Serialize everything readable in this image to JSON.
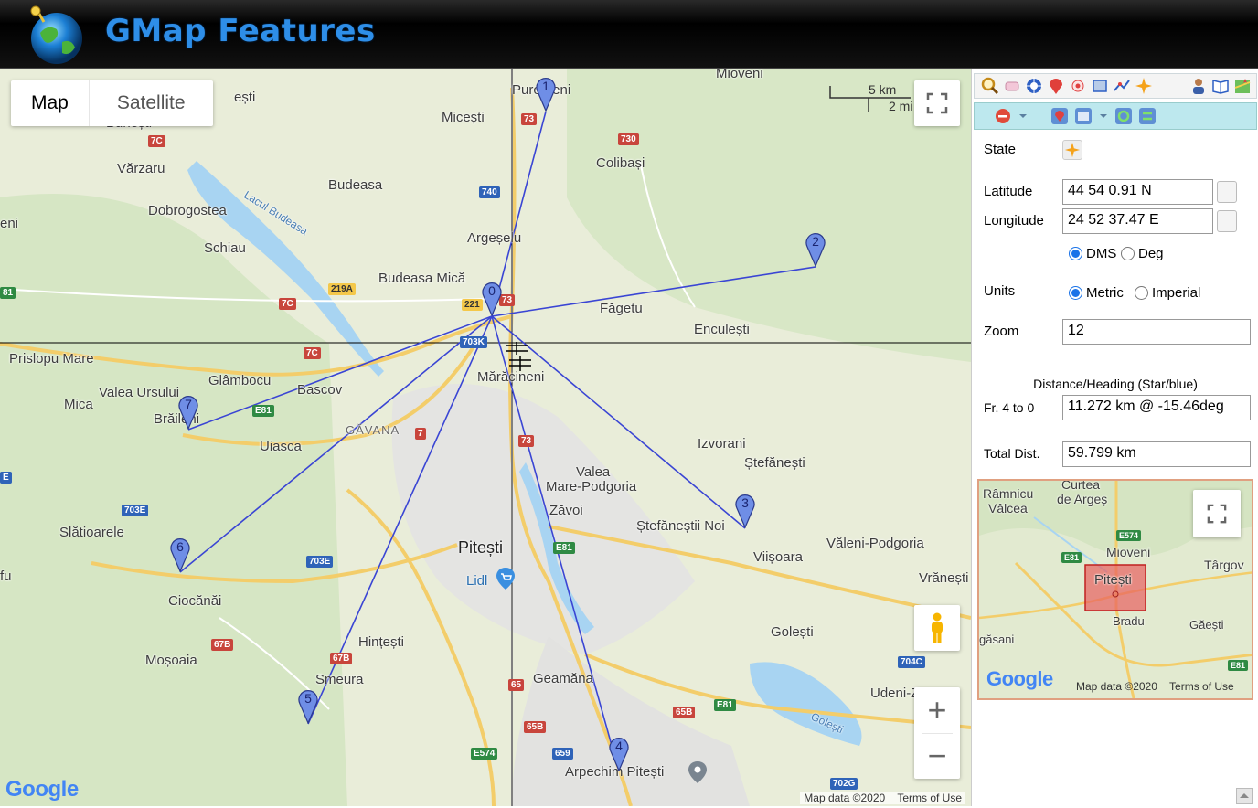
{
  "header": {
    "title": "GMap Features"
  },
  "map": {
    "map_type_buttons": [
      "Map",
      "Satellite"
    ],
    "scale": {
      "km": "5 km",
      "mi": "2 mi"
    },
    "footer": {
      "data": "Map data ©2020",
      "terms": "Terms of Use"
    },
    "google_logo": "Google",
    "places": [
      {
        "id": "p1",
        "text": "Mioveni"
      },
      {
        "id": "p2",
        "text": "Purcăreni"
      },
      {
        "id": "p3",
        "text": "Micești"
      },
      {
        "id": "p4",
        "text": "Colibași"
      },
      {
        "id": "p5",
        "text": "Vărzaru"
      },
      {
        "id": "p6",
        "text": "Budeasa"
      },
      {
        "id": "p7",
        "text": "Dobrogostea"
      },
      {
        "id": "p8",
        "text": "Schiau"
      },
      {
        "id": "p9",
        "text": "Argeșelu"
      },
      {
        "id": "p10",
        "text": "Budeasa Mică"
      },
      {
        "id": "p11",
        "text": "Făgetu"
      },
      {
        "id": "p12",
        "text": "Enculești"
      },
      {
        "id": "p13",
        "text": "Prislopu Mare"
      },
      {
        "id": "p14",
        "text": "Glâmbocu"
      },
      {
        "id": "p15",
        "text": "Valea Ursului"
      },
      {
        "id": "p16",
        "text": "Mica"
      },
      {
        "id": "p17",
        "text": "Brăileni"
      },
      {
        "id": "p18",
        "text": "Bascov"
      },
      {
        "id": "p19",
        "text": "Mărăcineni"
      },
      {
        "id": "p20",
        "text": "Uiasca"
      },
      {
        "id": "p21",
        "text": "Izvorani"
      },
      {
        "id": "p22",
        "text": "Ștefănești"
      },
      {
        "id": "p23",
        "text": "Valea"
      },
      {
        "id": "p24",
        "text": "Mare-Podgoria"
      },
      {
        "id": "p25",
        "text": "Zăvoi"
      },
      {
        "id": "p26",
        "text": "Ștefăneștii Noi"
      },
      {
        "id": "p27",
        "text": "Slătioarele"
      },
      {
        "id": "p28",
        "text": "Pitești"
      },
      {
        "id": "p29",
        "text": "Viișoara"
      },
      {
        "id": "p30",
        "text": "Văleni-Podgoria"
      },
      {
        "id": "p31",
        "text": "Lidl"
      },
      {
        "id": "p32",
        "text": "Vrănești"
      },
      {
        "id": "p33",
        "text": "Ciocănăi"
      },
      {
        "id": "p34",
        "text": "Moșoaia"
      },
      {
        "id": "p35",
        "text": "Hințești"
      },
      {
        "id": "p36",
        "text": "Golești"
      },
      {
        "id": "p37",
        "text": "Smeura"
      },
      {
        "id": "p38",
        "text": "Geamăna"
      },
      {
        "id": "p39",
        "text": "Udeni-Z"
      },
      {
        "id": "p40",
        "text": "Arpechim Pitești"
      },
      {
        "id": "p41",
        "text": "Lacul Budeasa"
      },
      {
        "id": "p42",
        "text": "GĂVANA"
      },
      {
        "id": "p43",
        "text": "Golești"
      },
      {
        "id": "p44",
        "text": "ești"
      },
      {
        "id": "p45",
        "text": "Bunești"
      },
      {
        "id": "p46",
        "text": "eni"
      },
      {
        "id": "p47",
        "text": "fu"
      }
    ],
    "roads": [
      {
        "id": "r1",
        "text": "73"
      },
      {
        "id": "r2",
        "text": "730"
      },
      {
        "id": "r3",
        "text": "7C"
      },
      {
        "id": "r4",
        "text": "740"
      },
      {
        "id": "r5",
        "text": "219A"
      },
      {
        "id": "r6",
        "text": "7C"
      },
      {
        "id": "r7",
        "text": "221"
      },
      {
        "id": "r8",
        "text": "73"
      },
      {
        "id": "r9",
        "text": "703K"
      },
      {
        "id": "r10",
        "text": "7C"
      },
      {
        "id": "r11",
        "text": "E81"
      },
      {
        "id": "r12",
        "text": "7"
      },
      {
        "id": "r13",
        "text": "73"
      },
      {
        "id": "r14",
        "text": "703E"
      },
      {
        "id": "r15",
        "text": "703E"
      },
      {
        "id": "r16",
        "text": "E81"
      },
      {
        "id": "r17",
        "text": "67B"
      },
      {
        "id": "r18",
        "text": "67B"
      },
      {
        "id": "r19",
        "text": "65"
      },
      {
        "id": "r20",
        "text": "65B"
      },
      {
        "id": "r21",
        "text": "65B"
      },
      {
        "id": "r22",
        "text": "E81"
      },
      {
        "id": "r23",
        "text": "E574"
      },
      {
        "id": "r24",
        "text": "659"
      },
      {
        "id": "r25",
        "text": "704C"
      },
      {
        "id": "r26",
        "text": "702G"
      },
      {
        "id": "r27",
        "text": "81"
      },
      {
        "id": "r28",
        "text": "E"
      }
    ],
    "markers": [
      "0",
      "1",
      "2",
      "3",
      "4",
      "5",
      "6",
      "7"
    ]
  },
  "panel": {
    "state_label": "State",
    "latitude_label": "Latitude",
    "latitude_value": "44 54 0.91 N",
    "longitude_label": "Longitude",
    "longitude_value": "24 52 37.47 E",
    "format_options": [
      "DMS",
      "Deg"
    ],
    "format_selected": "DMS",
    "units_label": "Units",
    "units_options": [
      "Metric",
      "Imperial"
    ],
    "units_selected": "Metric",
    "zoom_label": "Zoom",
    "zoom_value": "12",
    "distance_heading_title": "Distance/Heading (Star/blue)",
    "segment_label": "Fr. 4 to 0",
    "segment_value": "11.272 km @ -15.46deg",
    "total_label": "Total Dist.",
    "total_value": "59.799 km"
  },
  "minimap": {
    "places": [
      {
        "id": "m1",
        "text": "Râmnicu"
      },
      {
        "id": "m2",
        "text": "Vâlcea"
      },
      {
        "id": "m3",
        "text": "Curtea"
      },
      {
        "id": "m4",
        "text": "de Argeș"
      },
      {
        "id": "m5",
        "text": "Mioveni"
      },
      {
        "id": "m6",
        "text": "Pitești"
      },
      {
        "id": "m7",
        "text": "Târgov"
      },
      {
        "id": "m8",
        "text": "Bradu"
      },
      {
        "id": "m9",
        "text": "Găești"
      },
      {
        "id": "m10",
        "text": "găsani"
      }
    ],
    "roads": [
      {
        "id": "mr1",
        "text": "E574"
      },
      {
        "id": "mr2",
        "text": "E81"
      },
      {
        "id": "mr3",
        "text": "E81"
      }
    ],
    "footer": {
      "data": "Map data ©2020",
      "terms": "Terms of Use"
    },
    "google_logo": "Google"
  }
}
